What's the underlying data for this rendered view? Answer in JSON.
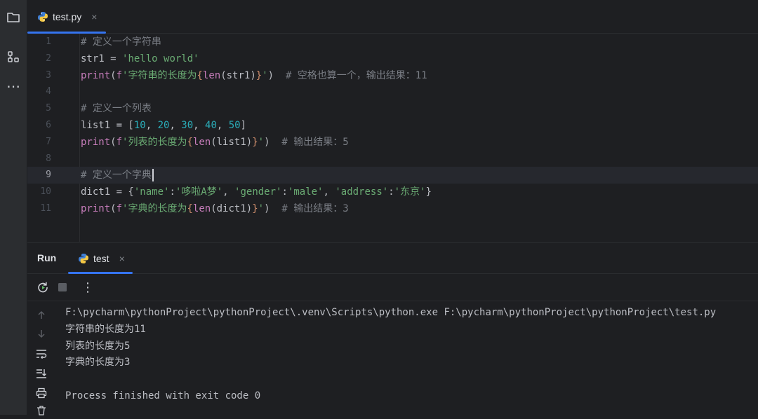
{
  "editor": {
    "tab": {
      "label": "test.py",
      "close": "×"
    },
    "lines": [
      {
        "n": "1",
        "segs": [
          {
            "c": "cmt",
            "t": "# 定义一个字符串"
          }
        ]
      },
      {
        "n": "2",
        "segs": [
          {
            "c": "plain",
            "t": "str1 = "
          },
          {
            "c": "str",
            "t": "'hello world'"
          }
        ]
      },
      {
        "n": "3",
        "segs": [
          {
            "c": "kw",
            "t": "print"
          },
          {
            "c": "plain",
            "t": "("
          },
          {
            "c": "kw",
            "t": "f"
          },
          {
            "c": "str",
            "t": "'字符串的长度为"
          },
          {
            "c": "brace",
            "t": "{"
          },
          {
            "c": "kw",
            "t": "len"
          },
          {
            "c": "plain",
            "t": "(str1)"
          },
          {
            "c": "brace",
            "t": "}"
          },
          {
            "c": "str",
            "t": "'"
          },
          {
            "c": "plain",
            "t": ")  "
          },
          {
            "c": "cmt",
            "t": "# 空格也算一个，输出结果：11"
          }
        ]
      },
      {
        "n": "4",
        "segs": []
      },
      {
        "n": "5",
        "segs": [
          {
            "c": "cmt",
            "t": "# 定义一个列表"
          }
        ]
      },
      {
        "n": "6",
        "segs": [
          {
            "c": "plain",
            "t": "list1 = ["
          },
          {
            "c": "num",
            "t": "10"
          },
          {
            "c": "plain",
            "t": ", "
          },
          {
            "c": "num",
            "t": "20"
          },
          {
            "c": "plain",
            "t": ", "
          },
          {
            "c": "num",
            "t": "30"
          },
          {
            "c": "plain",
            "t": ", "
          },
          {
            "c": "num",
            "t": "40"
          },
          {
            "c": "plain",
            "t": ", "
          },
          {
            "c": "num",
            "t": "50"
          },
          {
            "c": "plain",
            "t": "]"
          }
        ]
      },
      {
        "n": "7",
        "segs": [
          {
            "c": "kw",
            "t": "print"
          },
          {
            "c": "plain",
            "t": "("
          },
          {
            "c": "kw",
            "t": "f"
          },
          {
            "c": "str",
            "t": "'列表的长度为"
          },
          {
            "c": "brace",
            "t": "{"
          },
          {
            "c": "kw",
            "t": "len"
          },
          {
            "c": "plain",
            "t": "(list1)"
          },
          {
            "c": "brace",
            "t": "}"
          },
          {
            "c": "str",
            "t": "'"
          },
          {
            "c": "plain",
            "t": ")  "
          },
          {
            "c": "cmt",
            "t": "# 输出结果：5"
          }
        ]
      },
      {
        "n": "8",
        "segs": []
      },
      {
        "n": "9",
        "current": true,
        "segs": [
          {
            "c": "cmt",
            "t": "# 定义一个字典"
          }
        ]
      },
      {
        "n": "10",
        "segs": [
          {
            "c": "plain",
            "t": "dict1 = {"
          },
          {
            "c": "str",
            "t": "'name'"
          },
          {
            "c": "plain",
            "t": ":"
          },
          {
            "c": "str",
            "t": "'哆啦A梦'"
          },
          {
            "c": "plain",
            "t": ", "
          },
          {
            "c": "str",
            "t": "'gender'"
          },
          {
            "c": "plain",
            "t": ":"
          },
          {
            "c": "str",
            "t": "'male'"
          },
          {
            "c": "plain",
            "t": ", "
          },
          {
            "c": "str",
            "t": "'address'"
          },
          {
            "c": "plain",
            "t": ":"
          },
          {
            "c": "str",
            "t": "'东京'"
          },
          {
            "c": "plain",
            "t": "}"
          }
        ]
      },
      {
        "n": "11",
        "segs": [
          {
            "c": "kw",
            "t": "print"
          },
          {
            "c": "plain",
            "t": "("
          },
          {
            "c": "kw",
            "t": "f"
          },
          {
            "c": "str",
            "t": "'字典的长度为"
          },
          {
            "c": "brace",
            "t": "{"
          },
          {
            "c": "kw",
            "t": "len"
          },
          {
            "c": "plain",
            "t": "(dict1)"
          },
          {
            "c": "brace",
            "t": "}"
          },
          {
            "c": "str",
            "t": "'"
          },
          {
            "c": "plain",
            "t": ")  "
          },
          {
            "c": "cmt",
            "t": "# 输出结果：3"
          }
        ]
      }
    ]
  },
  "run": {
    "title": "Run",
    "tab": {
      "label": "test",
      "close": "×"
    },
    "more": "⋮",
    "console": [
      "F:\\pycharm\\pythonProject\\pythonProject\\.venv\\Scripts\\python.exe F:\\pycharm\\pythonProject\\pythonProject\\test.py",
      "字符串的长度为11",
      "列表的长度为5",
      "字典的长度为3",
      "",
      "Process finished with exit code 0"
    ]
  },
  "toolstrip": {
    "more": "⋯"
  },
  "colors": {
    "accent": "#3574f0",
    "background": "#1e1f22",
    "panel": "#2b2d30"
  }
}
